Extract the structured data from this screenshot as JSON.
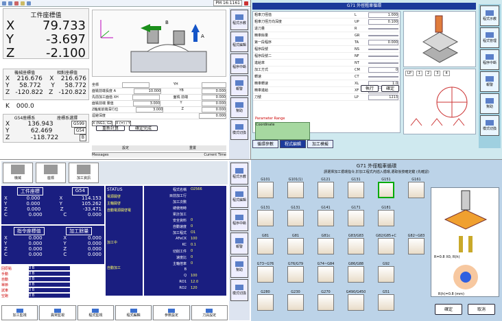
{
  "q1": {
    "clock": "PM 16:1161",
    "work_title": "工件座標值",
    "axes": [
      {
        "n": "X",
        "v": "79.733"
      },
      {
        "n": "Y",
        "v": "-3.697"
      },
      {
        "n": "Z",
        "v": "-2.100"
      }
    ],
    "mech_label": "機械座標值",
    "rel_label": "相對座標值",
    "mech": [
      {
        "n": "X",
        "v": "216.676"
      },
      {
        "n": "Y",
        "v": "58.772"
      },
      {
        "n": "Z",
        "v": "-120.822"
      }
    ],
    "rel": [
      {
        "n": "X",
        "v": "216.676"
      },
      {
        "n": "Y",
        "v": "58.772"
      },
      {
        "n": "Z",
        "v": "-120.822"
      }
    ],
    "k": {
      "n": "K",
      "v": "000.0"
    },
    "g54_label": "G54座標系",
    "wc_label": "座標系選擇",
    "g54": [
      {
        "n": "X",
        "v": "136.943"
      },
      {
        "n": "Y",
        "v": "62.469"
      },
      {
        "n": "Z",
        "v": "-118.722"
      }
    ],
    "wc_values": [
      "G599",
      "G54",
      "B"
    ],
    "diagram_labels": [
      "B",
      "A"
    ],
    "params": [
      {
        "k": "坐標",
        "v": ""
      },
      {
        "k": "面铣前端長度 A",
        "v": "10.000"
      },
      {
        "k": "先前加工面值 XH",
        "v": ""
      },
      {
        "k": "面铣前端 量值",
        "v": "3.000"
      },
      {
        "k": "Z軸底前端深行位",
        "v": "3.000"
      },
      {
        "k": "迴避深度",
        "v": "0.000"
      }
    ],
    "params_right": [
      {
        "k": "YH",
        "v": ""
      },
      {
        "k": "YB",
        "v": "0.000"
      },
      {
        "k": "面铣 前端",
        "v": "0.000"
      },
      {
        "k": "Y",
        "v": "0.000"
      },
      {
        "k": "Z",
        "v": "0.000"
      }
    ],
    "combo_a": "X (NG1, G2",
    "combo_b": "X (=) / Y",
    "btn_recalc": "重新計算",
    "btn_apply": "確定完成",
    "footer": [
      "設定",
      "重置"
    ],
    "msg_label": "Messages",
    "time_label": "Current Time",
    "side": [
      "程式示教",
      "程式編輯",
      "程序中斷",
      "報警",
      "幫助",
      "模式切換"
    ]
  },
  "q2": {
    "header": "G71 外徑粗車循環",
    "rows": [
      {
        "k": "粗車刀徑值",
        "c": "L",
        "v": "1.000"
      },
      {
        "k": "粗車刀徑方向深度",
        "c": "UP",
        "v": "0.100"
      },
      {
        "k": "退刀量",
        "c": "R",
        "v": ""
      },
      {
        "k": "精車餘量",
        "c": "GR",
        "v": ""
      },
      {
        "k": "第一段程序",
        "c": "TA",
        "v": "0.000"
      },
      {
        "k": "程序段號",
        "c": "NS",
        "v": ""
      },
      {
        "k": "程序段號二",
        "c": "NF",
        "v": ""
      },
      {
        "k": "進給率",
        "c": "NT",
        "v": ""
      },
      {
        "k": "加工方式",
        "c": "CM",
        "v": "0"
      },
      {
        "k": "轉速",
        "c": "CT",
        "v": ""
      },
      {
        "k": "精車轉速",
        "c": "XL",
        "v": "1.0"
      },
      {
        "k": "精車進給",
        "c": "XF",
        "v": "1.0"
      },
      {
        "k": "刀號",
        "c": "LP",
        "v": "1213"
      }
    ],
    "param_group": "Parameter Range",
    "coord_label": "Coordinate",
    "lp_row": [
      "LP",
      "1",
      "2",
      "3",
      "4"
    ],
    "tool_no": "LP",
    "buttons": [
      "執行",
      "確定"
    ],
    "tabs": [
      "循環參數",
      "程式編輯",
      "加工模擬"
    ],
    "side": [
      "程式示教",
      "程式管理",
      "程序中斷",
      "報警",
      "幫助",
      "模式切換"
    ]
  },
  "q3": {
    "tabs": [
      "機械",
      "座標",
      "加工資訊"
    ],
    "work_title": "工件座標",
    "g_title": "G54",
    "work": [
      {
        "n": "X",
        "v": "0.000"
      },
      {
        "n": "Y",
        "v": "0.000"
      },
      {
        "n": "Z",
        "v": "0.000"
      },
      {
        "n": "C",
        "v": "0.000"
      }
    ],
    "g54": [
      {
        "n": "X",
        "v": "114.153"
      },
      {
        "n": "Y",
        "v": "105.262"
      },
      {
        "n": "Z",
        "v": "-33.471"
      },
      {
        "n": "C",
        "v": "0.000"
      }
    ],
    "cmd_title": "指令座標值",
    "mach_title": "加工餘量",
    "cmd": [
      {
        "n": "X",
        "v": "0.000"
      },
      {
        "n": "Y",
        "v": "0.000"
      },
      {
        "n": "Z",
        "v": "0.000"
      },
      {
        "n": "C",
        "v": "0.000"
      }
    ],
    "mach": [
      {
        "n": "X",
        "v": "0.000"
      },
      {
        "n": "Y",
        "v": "0.000"
      },
      {
        "n": "Z",
        "v": "0.000"
      },
      {
        "n": "C",
        "v": "0.000"
      }
    ],
    "status_title": "STATUS",
    "status": [
      "電源開啓",
      "主軸開啓",
      "自動電源開啓電"
    ],
    "mode": "加工中",
    "mode2": "自動加工",
    "info": [
      {
        "k": "程式名稱",
        "v": "O2566"
      },
      {
        "k": "目前加工行",
        "v": ""
      },
      {
        "k": "加工次數",
        "v": ""
      },
      {
        "k": "總使用時",
        "v": ""
      },
      {
        "k": "累計加工",
        "v": ""
      },
      {
        "k": "安全資料",
        "v": "0"
      },
      {
        "k": "自動速度",
        "v": "0"
      },
      {
        "k": "加工程式",
        "v": "O1"
      },
      {
        "k": "AFeCK",
        "v": "100"
      },
      {
        "k": "KC",
        "v": "0.1"
      },
      {
        "k": "切削工件",
        "v": "0"
      },
      {
        "k": "速度比",
        "v": "0"
      },
      {
        "k": "主軸倍率",
        "v": "0"
      },
      {
        "k": "B",
        "v": ""
      },
      {
        "k": "Q",
        "v": "100"
      },
      {
        "k": "RO1",
        "v": "12.0"
      },
      {
        "k": "RO2",
        "v": "120"
      }
    ],
    "alarm_labels": [
      "回原點",
      "手動",
      "自動",
      "單節",
      "試車",
      "空跑"
    ],
    "alarm_vals": [
      "0 B",
      "0 B",
      "0 B",
      "0 B",
      "0 B",
      "0 B"
    ],
    "bottom": [
      "加工監視",
      "異常監視",
      "程式監視",
      "程式編輯",
      "參數設定",
      "刀具設定"
    ],
    "side": [
      "程式示教",
      "程式編輯",
      "程序中斷",
      "報警",
      "幫助",
      "模式切換"
    ]
  },
  "q4": {
    "title": "G71 外徑粗車循環",
    "subtitle": "請選擇加工循環指令,於加工程式內插入循環,選取後按確定鍵 (先確認)",
    "groups": [
      [
        "G101",
        "G101(1)",
        "G121",
        "G131",
        "G151",
        "G161"
      ],
      [
        "G131",
        "G131",
        "G141",
        "G171",
        "G181"
      ],
      [
        "G81",
        "G81",
        "G81c",
        "G83/G83",
        "G82/G85+C",
        "G82~G83"
      ],
      [
        "G73~G76",
        "G76/G79",
        "G74~G84",
        "G86/G88",
        "G92"
      ],
      [
        "G280",
        "G230",
        "G270",
        "G490/G450",
        "G51"
      ]
    ],
    "diag": [
      "R=0.8 X0, R(h)",
      "R(h)=0.8 (mm)"
    ],
    "btn_ok": "確定",
    "btn_cancel": "取消"
  }
}
